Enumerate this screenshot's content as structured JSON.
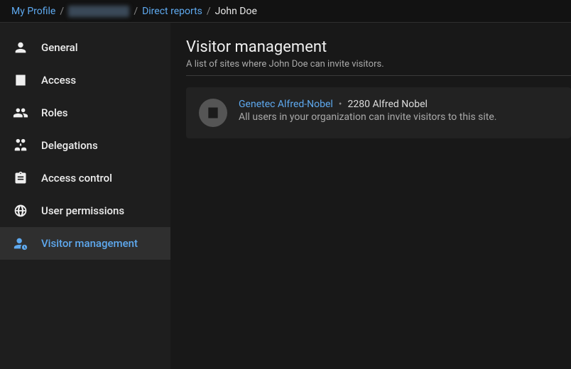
{
  "breadcrumb": {
    "items": [
      {
        "label": "My Profile",
        "type": "link"
      },
      {
        "label": "blurred name",
        "type": "blurred"
      },
      {
        "label": "Direct reports",
        "type": "link"
      },
      {
        "label": "John Doe",
        "type": "current"
      }
    ],
    "sep": "/"
  },
  "sidebar": {
    "items": [
      {
        "label": "General",
        "icon": "person-icon",
        "active": false
      },
      {
        "label": "Access",
        "icon": "building-icon",
        "active": false
      },
      {
        "label": "Roles",
        "icon": "people-icon",
        "active": false
      },
      {
        "label": "Delegations",
        "icon": "handoff-icon",
        "active": false
      },
      {
        "label": "Access control",
        "icon": "clipboard-icon",
        "active": false
      },
      {
        "label": "User permissions",
        "icon": "globe-icon",
        "active": false
      },
      {
        "label": "Visitor management",
        "icon": "person-clock-icon",
        "active": true
      }
    ]
  },
  "main": {
    "title": "Visitor management",
    "subtitle": "A list of sites where John Doe can invite visitors.",
    "sites": [
      {
        "name": "Genetec Alfred-Nobel",
        "address": "2280 Alfred Nobel",
        "description": "All users in your organization can invite visitors to this site."
      }
    ]
  }
}
